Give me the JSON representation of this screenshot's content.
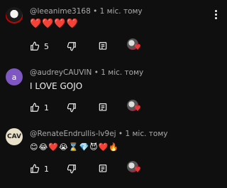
{
  "comments": [
    {
      "author": "@leeanime3168",
      "time": "1 міс. тому",
      "text": "❤️❤️❤️❤️",
      "likes": "5",
      "avatar_letter": ""
    },
    {
      "author": "@audreyCAUVIN",
      "time": "1 міс. тому",
      "text": "I LOVE GOJO",
      "likes": "1",
      "avatar_letter": "a"
    },
    {
      "author": "@RenateEndrullis-lv9ej",
      "time": "1 міс. тому",
      "text": "😊😂❤️😭⌛💎😈❤️🔥",
      "likes": "1",
      "avatar_letter": "CAV"
    }
  ],
  "separator": "•",
  "colors": {
    "background": "#0f0f0f",
    "text_primary": "#f1f1f1",
    "text_secondary": "#aaaaaa",
    "heart": "#e53935",
    "avatar_letter_bg": "#7e57c2"
  },
  "icons": [
    "like-icon",
    "dislike-icon",
    "reply-icon",
    "creator-heart-icon",
    "more-vert-icon"
  ]
}
